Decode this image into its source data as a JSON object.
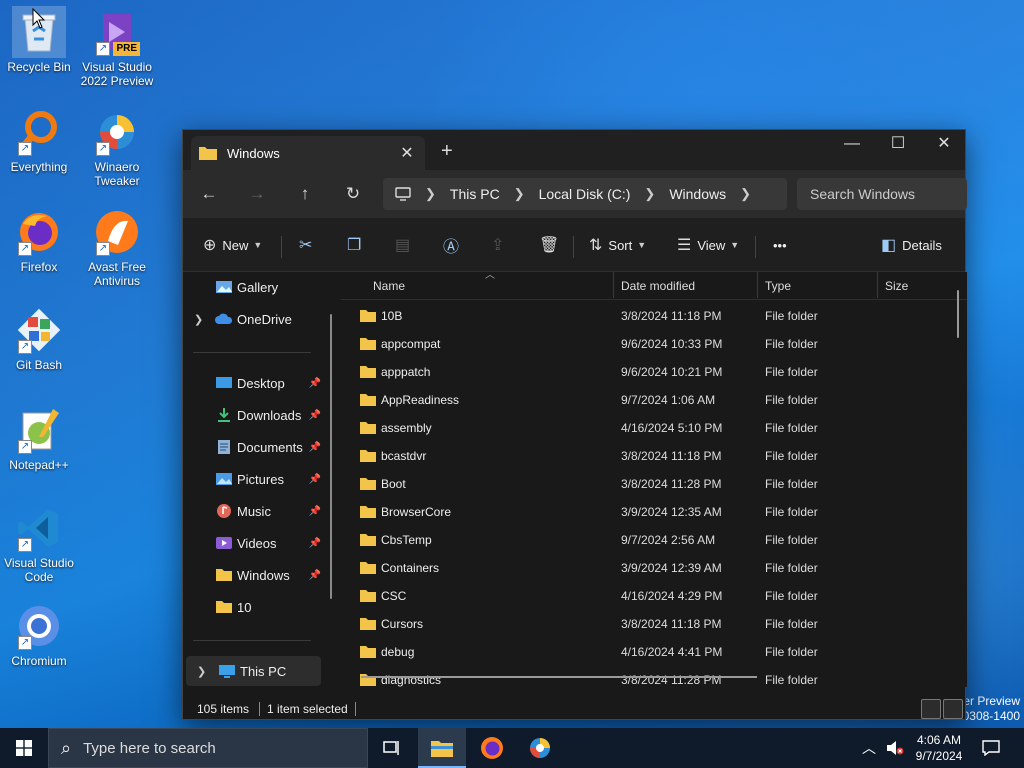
{
  "desktop": {
    "icons": [
      {
        "label": "Recycle Bin"
      },
      {
        "label": "Visual Studio 2022 Preview",
        "badge": "PRE"
      },
      {
        "label": "Everything"
      },
      {
        "label": "Winaero Tweaker"
      },
      {
        "label": "Firefox"
      },
      {
        "label": "Avast Free Antivirus"
      },
      {
        "label": "Git Bash"
      },
      {
        "label": "Notepad++"
      },
      {
        "label": "Visual Studio Code"
      },
      {
        "label": "Chromium"
      }
    ],
    "watermark_line1": "er Preview",
    "watermark_line2": "0308-1400"
  },
  "window": {
    "tab_title": "Windows",
    "new_tab": "+",
    "controls": {
      "minimize": "—",
      "maximize": "☐",
      "close": "✕"
    },
    "breadcrumbs": [
      "This PC",
      "Local Disk (C:)",
      "Windows"
    ],
    "search_placeholder": "Search Windows",
    "commands": {
      "new": "New",
      "sort": "Sort",
      "view": "View",
      "more": "•••",
      "details": "Details"
    },
    "nav": {
      "gallery": "Gallery",
      "onedrive": "OneDrive",
      "desktop": "Desktop",
      "downloads": "Downloads",
      "documents": "Documents",
      "pictures": "Pictures",
      "music": "Music",
      "videos": "Videos",
      "windows": "Windows",
      "ten": "10",
      "thispc": "This PC"
    },
    "columns": {
      "name": "Name",
      "date": "Date modified",
      "type": "Type",
      "size": "Size"
    },
    "files": [
      {
        "name": "10B",
        "date": "3/8/2024 11:18 PM",
        "type": "File folder"
      },
      {
        "name": "appcompat",
        "date": "9/6/2024 10:33 PM",
        "type": "File folder"
      },
      {
        "name": "apppatch",
        "date": "9/6/2024 10:21 PM",
        "type": "File folder"
      },
      {
        "name": "AppReadiness",
        "date": "9/7/2024 1:06 AM",
        "type": "File folder"
      },
      {
        "name": "assembly",
        "date": "4/16/2024 5:10 PM",
        "type": "File folder"
      },
      {
        "name": "bcastdvr",
        "date": "3/8/2024 11:18 PM",
        "type": "File folder"
      },
      {
        "name": "Boot",
        "date": "3/8/2024 11:28 PM",
        "type": "File folder"
      },
      {
        "name": "BrowserCore",
        "date": "3/9/2024 12:35 AM",
        "type": "File folder"
      },
      {
        "name": "CbsTemp",
        "date": "9/7/2024 2:56 AM",
        "type": "File folder"
      },
      {
        "name": "Containers",
        "date": "3/9/2024 12:39 AM",
        "type": "File folder"
      },
      {
        "name": "CSC",
        "date": "4/16/2024 4:29 PM",
        "type": "File folder"
      },
      {
        "name": "Cursors",
        "date": "3/8/2024 11:18 PM",
        "type": "File folder"
      },
      {
        "name": "debug",
        "date": "4/16/2024 4:41 PM",
        "type": "File folder"
      },
      {
        "name": "diagnostics",
        "date": "3/8/2024 11:28 PM",
        "type": "File folder"
      }
    ],
    "status": {
      "items": "105 items",
      "selected": "1 item selected"
    }
  },
  "taskbar": {
    "search_placeholder": "Type here to search",
    "time": "4:06 AM",
    "date": "9/7/2024"
  },
  "colors": {
    "accent": "#78b6ff",
    "folder": "#f2c54a",
    "window_bg": "#191919"
  }
}
